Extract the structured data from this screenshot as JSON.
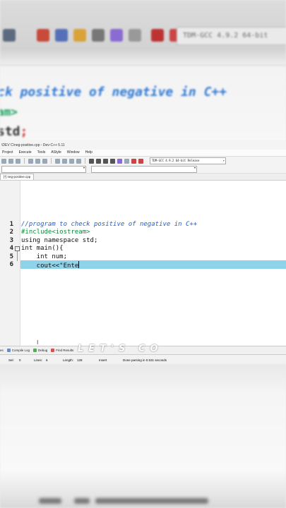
{
  "background": {
    "compiler_label": "TDM-GCC 4.9.2 64-bit",
    "code_line_1": "ck positive of negative in C++",
    "code_line_2": "am>",
    "code_line_3_a": " std",
    "code_line_3_b": ";"
  },
  "window": {
    "title": "\\DEV C\\neg-positive.cpp - Dev-C++ 5.11"
  },
  "menu": [
    "Project",
    "Execute",
    "Tools",
    "AStyle",
    "Window",
    "Help"
  ],
  "toolbar": {
    "compiler_select": "TDM-GCC 4.9.2 64-bit Release"
  },
  "tab": {
    "file": "[*] neg-positive.cpp"
  },
  "editor": {
    "lines": [
      {
        "num": "1",
        "text": "//program to check positive of negative in C++"
      },
      {
        "num": "2",
        "text": "#include<iostream>"
      },
      {
        "num": "3",
        "text": "using namespace std;"
      },
      {
        "num": "4",
        "text": "int main(){"
      },
      {
        "num": "5",
        "text": "    int num;"
      },
      {
        "num": "6",
        "text": "    cout<<\"Ente"
      }
    ],
    "fold_symbol": "−",
    "cursor_symbol": "I"
  },
  "bottom_tabs": [
    "es",
    "Compile Log",
    "Debug",
    "Find Results"
  ],
  "watermark": "LET'S CO",
  "status": {
    "sel_label": "Sel:",
    "sel_value": "0",
    "lines_label": "Lines:",
    "lines_value": "6",
    "length_label": "Length:",
    "length_value": "128",
    "mode": "Insert",
    "message": "Done parsing in 0.531 seconds"
  },
  "colors": {
    "comment": "#1f5fd1",
    "preprocessor": "#0a8a3a",
    "highlight": "#8fd3ea"
  }
}
